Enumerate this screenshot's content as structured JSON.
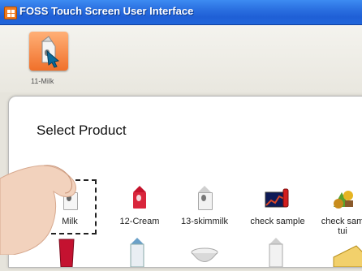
{
  "window": {
    "title": "FOSS Touch Screen User Interface"
  },
  "toolbar": {
    "selected_product_label": "11-Milk"
  },
  "dialog": {
    "title": "Select Product",
    "products": [
      {
        "label": "Milk",
        "icon": "milk-carton-icon",
        "selected": true
      },
      {
        "label": "12-Cream",
        "icon": "cream-carton-icon"
      },
      {
        "label": "13-skimmilk",
        "icon": "skimmilk-carton-icon"
      },
      {
        "label": "check sample",
        "icon": "check-sample-icon"
      },
      {
        "label": "check sam\ntui",
        "icon": "check-sample-tui-icon"
      }
    ]
  },
  "colors": {
    "titlebar": "#2a6fe0",
    "accent_orange": "#f0702a"
  }
}
